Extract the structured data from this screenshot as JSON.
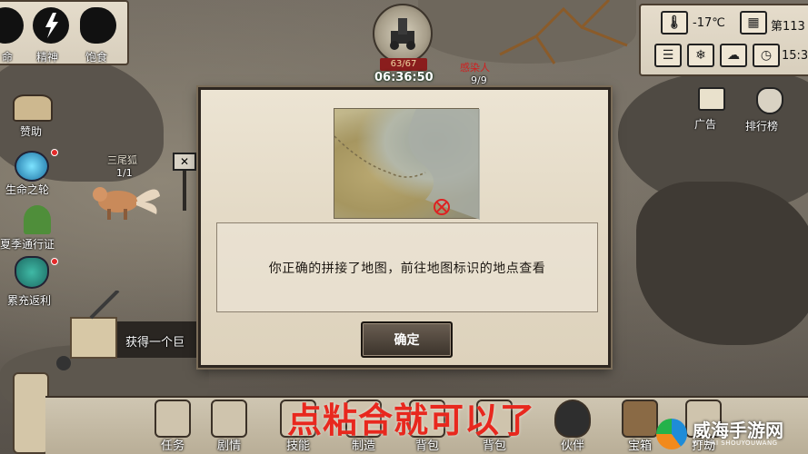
{
  "top_left_stats": [
    {
      "label": "命",
      "icon": "life-icon"
    },
    {
      "label": "精神",
      "icon": "lightning-icon"
    },
    {
      "label": "饱食",
      "icon": "stomach-icon"
    }
  ],
  "top_center": {
    "level": "63/67",
    "timer": "06:36:50",
    "enemy_label": "感染人",
    "enemy_count": "9/9"
  },
  "top_right": {
    "temperature": "-17℃",
    "day": "第113",
    "clock_time": "15:3"
  },
  "left_menu": [
    {
      "label": "赞助"
    },
    {
      "label": "生命之轮"
    },
    {
      "label": "夏季通行证"
    },
    {
      "label": "累充返利"
    }
  ],
  "right_menu": [
    {
      "label": "广告"
    },
    {
      "label": "排行榜"
    }
  ],
  "npc": {
    "name": "三尾狐",
    "count": "1/1"
  },
  "side_notice": "获得一个巨",
  "dialog": {
    "message": "你正确的拼接了地图，前往地图标识的地点查看",
    "confirm_label": "确定"
  },
  "bottom_bar": [
    {
      "label": "任务"
    },
    {
      "label": "剧情"
    },
    {
      "label": "技能"
    },
    {
      "label": "制造"
    },
    {
      "label": "背包"
    },
    {
      "label": "背包"
    },
    {
      "label": "伙伴"
    },
    {
      "label": "宝箱"
    },
    {
      "label": "打劫"
    }
  ],
  "overlay_caption": "点粘合就可以了",
  "watermark": {
    "name": "威海手游网",
    "sub": "WEIHAI SHOUYOUWANG"
  },
  "colors": {
    "caption": "#e8281e",
    "dialog_border": "#2d2620",
    "button_bg": "#4a4138"
  }
}
